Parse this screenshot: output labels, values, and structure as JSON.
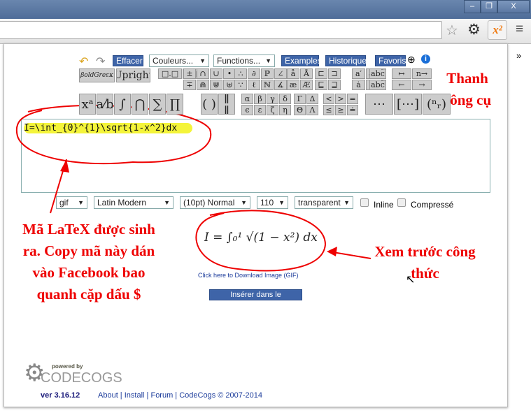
{
  "browser": {
    "window_buttons": [
      "–",
      "❐",
      "X"
    ],
    "ext_label": "x²",
    "overflow": "»"
  },
  "toolbar": {
    "effacer": "Effacer",
    "couleurs": "Couleurs...",
    "functions": "Functions...",
    "examples": "Examples",
    "historique": "Historique",
    "favoris": "Favoris",
    "boldgreek": "βoldGreεκ",
    "upright": "Upright",
    "groups": [
      [
        "□.□",
        "□.□"
      ],
      [
        "±",
        "∩",
        "∪",
        "•",
        "∓",
        "⋒",
        "⋓",
        "⊎"
      ],
      [
        "∴",
        "∂",
        "ℙ",
        "∠",
        "∵",
        "ℓ",
        "ℕ",
        "∡"
      ],
      [
        "å",
        "Å",
        "æ",
        "Æ"
      ],
      [
        "⊏",
        "⊐",
        "⊑",
        "⊒"
      ],
      [
        "a′",
        "a″",
        "ȧ",
        "ä"
      ],
      [
        "abc͡",
        "abc͡"
      ],
      [
        "↦",
        "n→",
        "←",
        "→"
      ]
    ],
    "big": [
      "xᵃ",
      "a⁄b",
      "∫",
      "⋂",
      "∑",
      "∏"
    ],
    "big2": [
      "( )",
      "‖ ‖"
    ],
    "greek": [
      "α",
      "β",
      "γ",
      "δ",
      "ϵ",
      "ε",
      "ζ",
      "η"
    ],
    "greekcap": [
      "Γ",
      "Δ",
      "Θ",
      "Λ"
    ],
    "rel": [
      "<",
      ">",
      "=",
      "≤",
      "≥",
      "≐"
    ],
    "big3": [
      "⋯",
      "[⋯]",
      "(ⁿᵣ)"
    ]
  },
  "editor": {
    "latex": "I=\\int_{0}^{1}\\sqrt{1-x^2}dx"
  },
  "options": {
    "format": "gif",
    "font": "Latin Modern",
    "size": "(10pt) Normal",
    "dpi": "110",
    "background": "transparent",
    "inline": "Inline",
    "compress": "Compressé"
  },
  "preview": {
    "formula": "I = ∫₀¹ √(1 − x²) dx",
    "download": "Click here to Download Image (GIF)",
    "insert": "Insérer dans le document"
  },
  "footer": {
    "powered": "powered by",
    "brand": "CODECOGS",
    "version": "ver 3.16.12",
    "links": [
      "About",
      "Install",
      "Forum",
      "CodeCogs © 2007-2014"
    ]
  },
  "annotations": {
    "toolbar": "Thanh công cụ",
    "latex": "Mã LaTeX được sinh ra. Copy mã này dán vào Facebook bao quanh cặp dấu $",
    "preview": "Xem trước công thức"
  }
}
